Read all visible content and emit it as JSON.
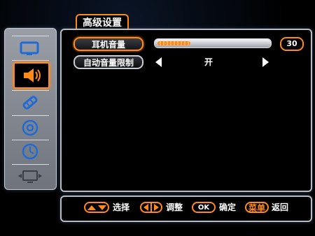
{
  "menu": {
    "title": "高级设置"
  },
  "sidebar": {
    "items": [
      {
        "icon": "tv-picture-icon",
        "active": false
      },
      {
        "icon": "speaker-sound-icon",
        "active": true
      },
      {
        "icon": "satellite-channel-icon",
        "active": false
      },
      {
        "icon": "settings-disc-icon",
        "active": false
      },
      {
        "icon": "clock-timer-icon",
        "active": false
      },
      {
        "icon": "input-source-icon",
        "active": false
      }
    ]
  },
  "settings": {
    "headphone_volume": {
      "label": "耳机音量",
      "value": "30",
      "level": 0.3
    },
    "auto_volume_limit": {
      "label": "自动音量限制",
      "value": "开"
    }
  },
  "footer": {
    "select_label": "选择",
    "adjust_label": "调整",
    "ok_key": "OK",
    "ok_label": "确定",
    "menu_key": "菜单",
    "back_label": "返回"
  },
  "colors": {
    "accent": "#ff8a1a",
    "frame": "#b8bcc4"
  }
}
